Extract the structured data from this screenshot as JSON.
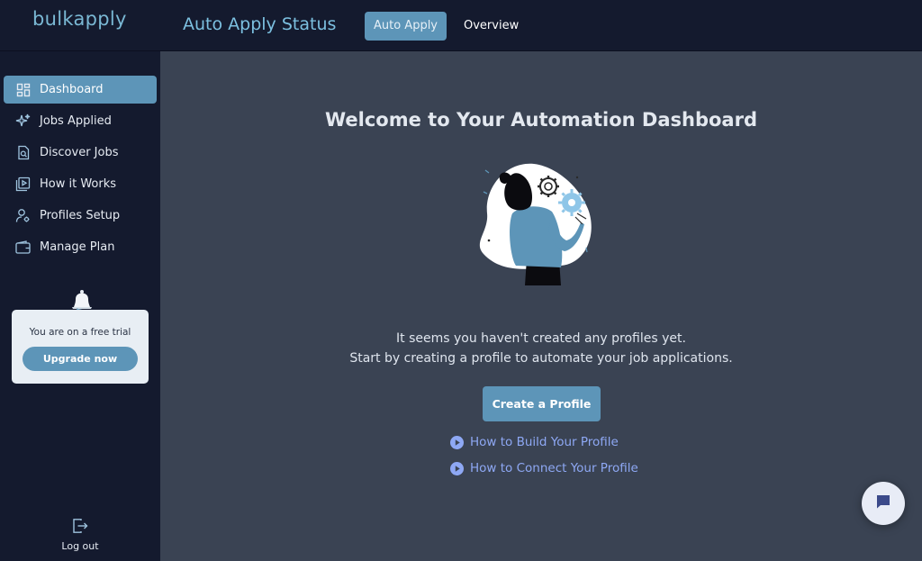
{
  "header": {
    "logo_text": "bulkapply",
    "page_title": "Auto Apply Status",
    "tabs": [
      {
        "label": "Auto Apply",
        "active": true
      },
      {
        "label": "Overview",
        "active": false
      }
    ]
  },
  "sidebar": {
    "items": [
      {
        "label": "Dashboard",
        "icon": "dashboard-icon",
        "active": true
      },
      {
        "label": "Jobs Applied",
        "icon": "sparkle-icon",
        "active": false
      },
      {
        "label": "Discover Jobs",
        "icon": "document-search-icon",
        "active": false
      },
      {
        "label": "How it Works",
        "icon": "video-library-icon",
        "active": false
      },
      {
        "label": "Profiles Setup",
        "icon": "user-settings-icon",
        "active": false
      },
      {
        "label": "Manage Plan",
        "icon": "wallet-icon",
        "active": false
      }
    ],
    "trial": {
      "text": "You are on a free trial",
      "button_label": "Upgrade now"
    },
    "logout_label": "Log out"
  },
  "main": {
    "welcome_title": "Welcome to Your Automation Dashboard",
    "message_line1": "It seems you haven't created any profiles yet.",
    "message_line2": "Start by creating a profile to automate your job applications.",
    "create_button": "Create a Profile",
    "links": [
      {
        "label": "How to Build Your Profile",
        "icon": "play-circle-icon"
      },
      {
        "label": "How to Connect Your Profile",
        "icon": "play-circle-icon"
      }
    ]
  },
  "colors": {
    "accent": "#5d95b8",
    "sidebar_bg": "#141a2e",
    "main_bg": "#3a4353",
    "link": "#8ea8f4",
    "title": "#7cc0e0"
  }
}
